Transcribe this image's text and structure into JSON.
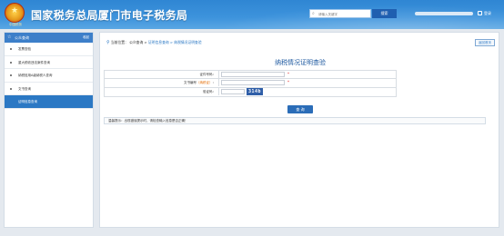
{
  "header": {
    "site_title": "国家税务总局厦门市电子税务局",
    "emblem_text": "中国税务",
    "search": {
      "placeholder": "请输入关键字"
    },
    "search_button": "搜索",
    "top_link": "登录"
  },
  "sidebar": {
    "title": "公众查询",
    "more": "收起",
    "items": [
      {
        "label": "发票查验"
      },
      {
        "label": "重大税收违法案件查询"
      },
      {
        "label": "纳税信用A级纳税人查询"
      },
      {
        "label": "文书查询"
      },
      {
        "label": "证明信息查询"
      }
    ]
  },
  "breadcrumb": {
    "prefix": "当前位置：",
    "items": [
      "公众查询",
      "证明信息查询",
      "纳税情况证明查验"
    ],
    "separator": " > "
  },
  "back_button": "返回首页",
  "page_title": "纳税情况证明查验",
  "form": {
    "fields": [
      {
        "label": "证件号码：",
        "value": "",
        "required_mark": "*"
      },
      {
        "label": "文书编号",
        "label_hint": "（纳税证）",
        "label_suffix": "：",
        "value": "",
        "required_mark": "*"
      },
      {
        "label": "验证码：",
        "value": "",
        "captcha": "314b"
      }
    ],
    "submit": "查 询"
  },
  "tip": "温馨提示：出现错误提示时，请检查输入信息是否正确！"
}
